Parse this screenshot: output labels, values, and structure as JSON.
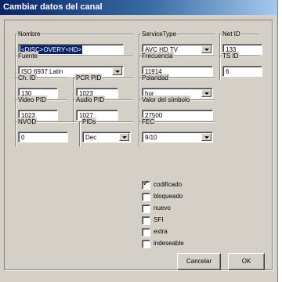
{
  "window": {
    "title": "Cambiar datos del canal"
  },
  "fields": {
    "nombre": {
      "label": "Nombre",
      "value": "<DISC>OVERY<HD>"
    },
    "service_type": {
      "label": "ServiceType",
      "value": "AVC HD TV"
    },
    "net_id": {
      "label": "Net ID",
      "value": "133"
    },
    "fuente": {
      "label": "Fuente",
      "value": "ISO 6937 Latin"
    },
    "frecuencia": {
      "label": "Frecuencia",
      "value": "11914"
    },
    "ts_id": {
      "label": "TS ID",
      "value": "6"
    },
    "ch_id": {
      "label": "Ch. ID",
      "value": "130"
    },
    "pcr_pid": {
      "label": "PCR PID",
      "value": "1023"
    },
    "polaridad": {
      "label": "Polaridad",
      "value": "hor"
    },
    "video_pid": {
      "label": "Video PID",
      "value": "1023"
    },
    "audio_pid": {
      "label": "Audio PID",
      "value": "1027"
    },
    "valor_simbolo": {
      "label": "Valor del símbolo",
      "value": "27500"
    },
    "nvod": {
      "label": "NVOD",
      "value": "0"
    },
    "pids": {
      "label": "PIDs",
      "value": "Dec"
    },
    "fec": {
      "label": "FEC",
      "value": "9/10"
    }
  },
  "checkboxes": [
    {
      "label": "codificado",
      "checked": true,
      "mark": "✓"
    },
    {
      "label": "bloqueado",
      "checked": false,
      "mark": ""
    },
    {
      "label": "nuevo",
      "checked": false,
      "mark": ""
    },
    {
      "label": "SFI",
      "checked": false,
      "mark": ""
    },
    {
      "label": "extra",
      "checked": false,
      "mark": ""
    },
    {
      "label": "indeseable",
      "checked": false,
      "mark": ""
    }
  ],
  "buttons": {
    "cancel": "Cancelar",
    "ok": "OK"
  },
  "colors": {
    "titlebar": "#0a246a",
    "face": "#d4d0c8",
    "selection": "#0a246a"
  }
}
